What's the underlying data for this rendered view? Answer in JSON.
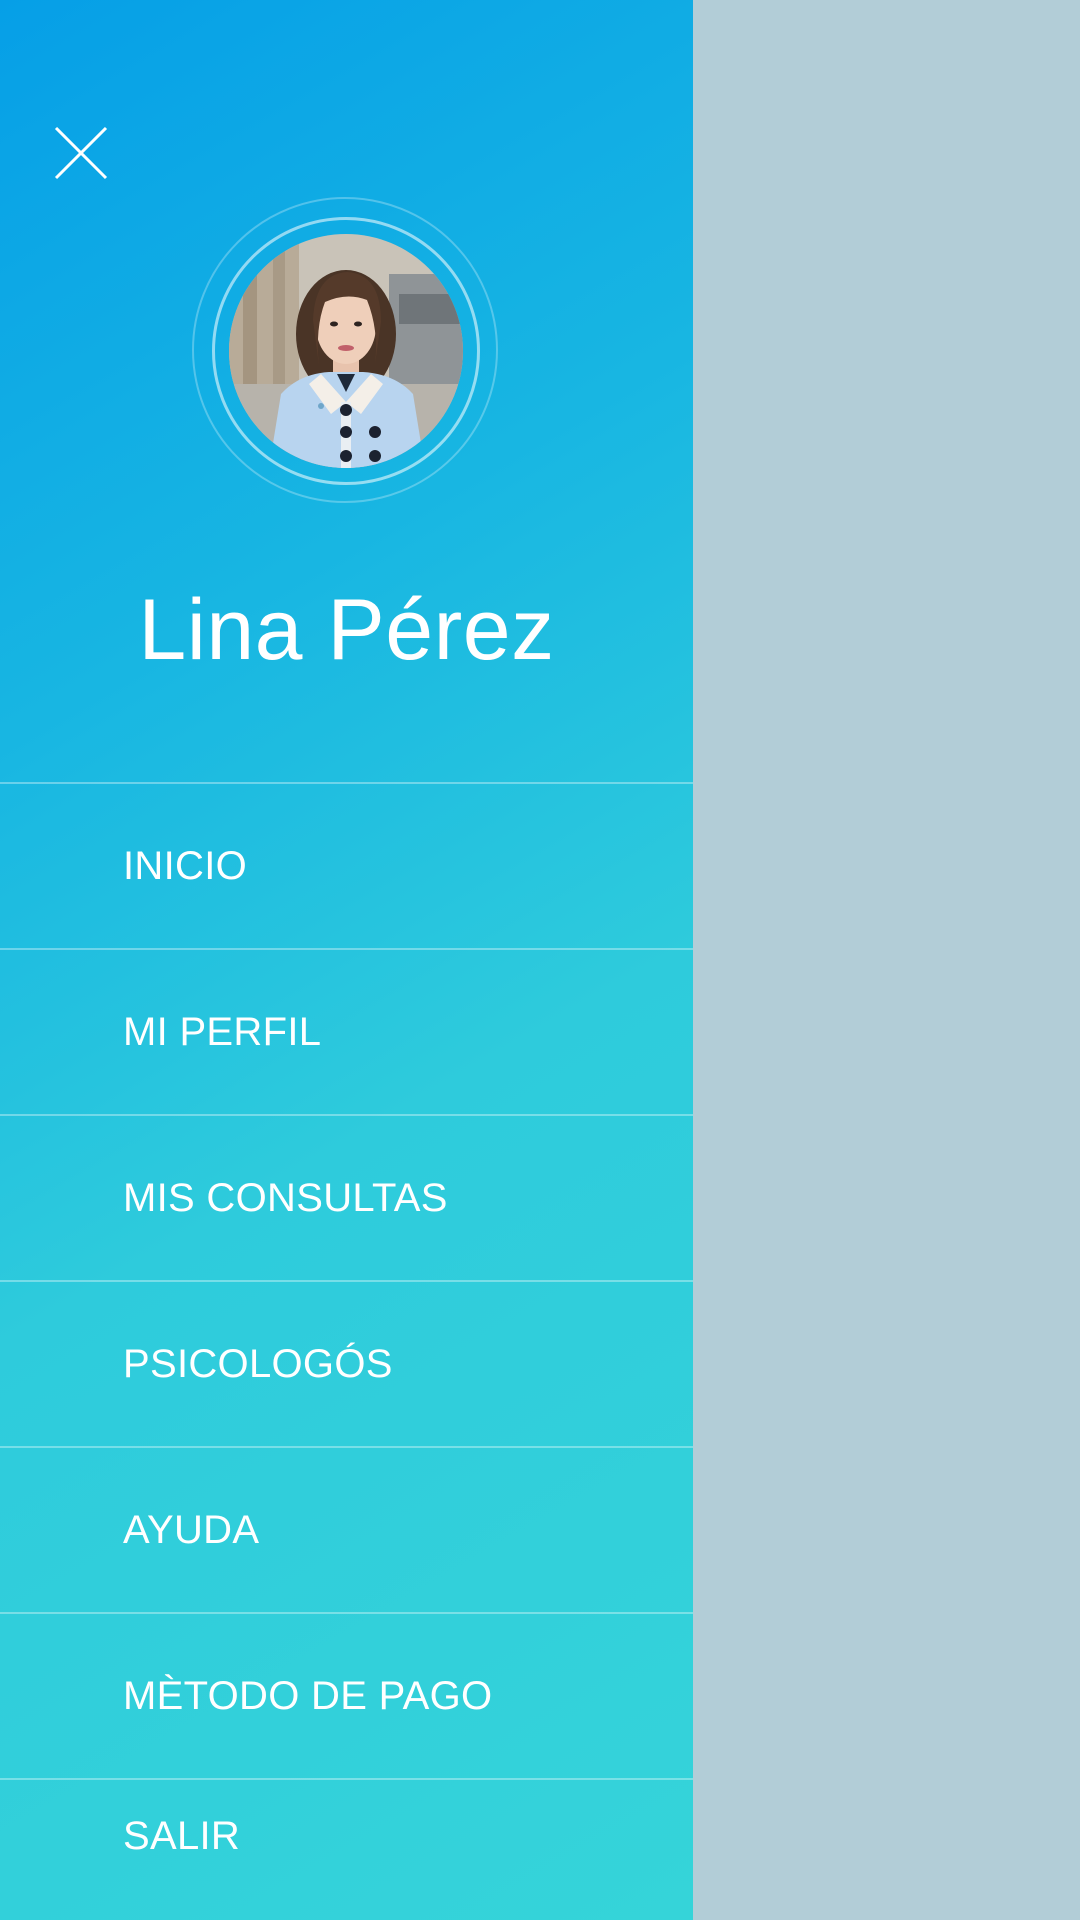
{
  "drawer": {
    "close_icon": "close-icon",
    "profile": {
      "name": "Lina Pérez",
      "avatar": "profile-photo"
    },
    "menu": [
      {
        "label": "INICIO"
      },
      {
        "label": "MI PERFIL"
      },
      {
        "label": "MIS CONSULTAS"
      },
      {
        "label": "PSICOLOGÓS"
      },
      {
        "label": "AYUDA"
      },
      {
        "label": "MÈTODO DE PAGO"
      },
      {
        "label": "SALIR"
      }
    ]
  },
  "colors": {
    "gradient_start": "#069fe7",
    "gradient_end": "#35d4d9",
    "scrim": "#b2cdd7",
    "text": "#ffffff"
  }
}
